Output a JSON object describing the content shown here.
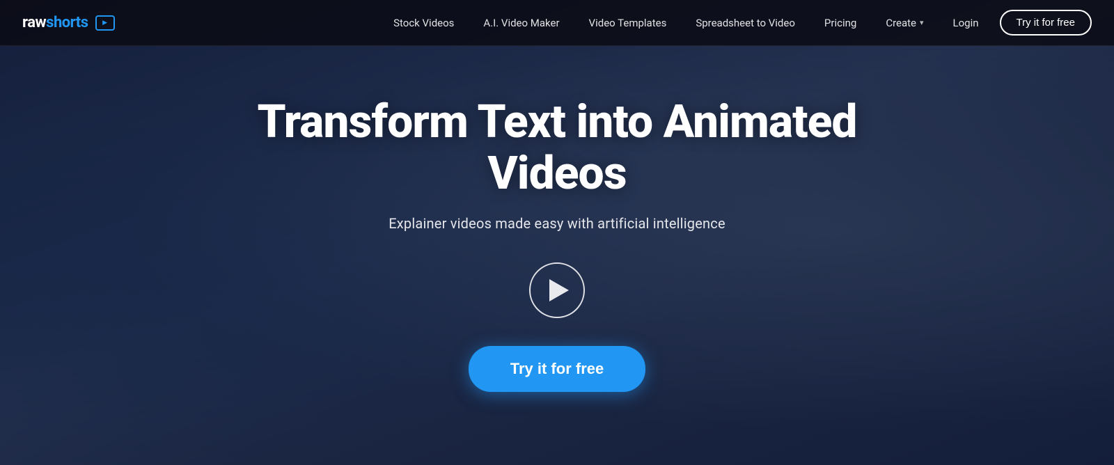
{
  "brand": {
    "name_raw": "raw",
    "name_shorts": "shorts",
    "logo_icon_label": "play-logo-icon"
  },
  "nav": {
    "links": [
      {
        "id": "stock-videos",
        "label": "Stock Videos"
      },
      {
        "id": "ai-video-maker",
        "label": "A.I. Video Maker"
      },
      {
        "id": "video-templates",
        "label": "Video Templates"
      },
      {
        "id": "spreadsheet-to-video",
        "label": "Spreadsheet to Video"
      },
      {
        "id": "pricing",
        "label": "Pricing"
      },
      {
        "id": "create",
        "label": "Create"
      }
    ],
    "login_label": "Login",
    "cta_label": "Try it for free"
  },
  "hero": {
    "title": "Transform Text into Animated Videos",
    "subtitle": "Explainer videos made easy with artificial intelligence",
    "cta_label": "Try it for free",
    "play_button_label": "Play demo video"
  }
}
